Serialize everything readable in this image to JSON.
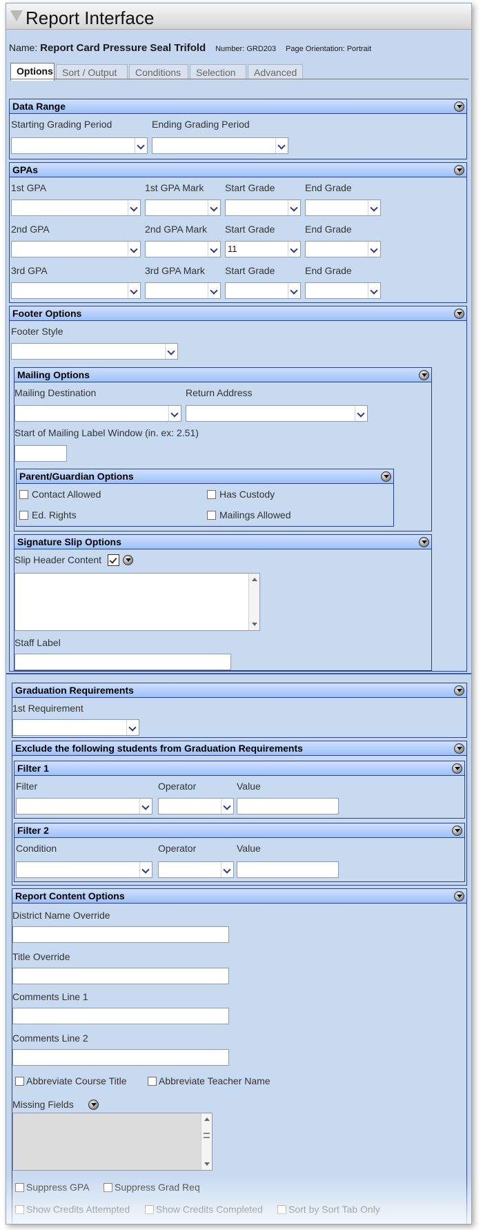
{
  "window": {
    "title": "Report Interface"
  },
  "report": {
    "name_label": "Name:",
    "name": "Report Card Pressure Seal Trifold",
    "number": "Number: GRD203",
    "orientation": "Page Orientation: Portrait"
  },
  "tabs": [
    {
      "label": "Options",
      "active": true
    },
    {
      "label": "Sort / Output"
    },
    {
      "label": "Conditions"
    },
    {
      "label": "Selection"
    },
    {
      "label": "Advanced"
    }
  ],
  "data_range": {
    "title": "Data Range",
    "starting_label": "Starting Grading Period",
    "ending_label": "Ending Grading Period",
    "starting_value": "",
    "ending_value": ""
  },
  "gpas": {
    "title": "GPAs",
    "rows": [
      {
        "gpa_label": "1st GPA",
        "mark_label": "1st GPA Mark",
        "start_label": "Start Grade",
        "end_label": "End Grade",
        "gpa": "",
        "mark": "",
        "start": "",
        "end": ""
      },
      {
        "gpa_label": "2nd GPA",
        "mark_label": "2nd GPA Mark",
        "start_label": "Start Grade",
        "end_label": "End Grade",
        "gpa": "",
        "mark": "",
        "start": "11",
        "end": ""
      },
      {
        "gpa_label": "3rd GPA",
        "mark_label": "3rd GPA Mark",
        "start_label": "Start Grade",
        "end_label": "End Grade",
        "gpa": "",
        "mark": "",
        "start": "",
        "end": ""
      }
    ]
  },
  "footer": {
    "title": "Footer Options",
    "style_label": "Footer Style",
    "style_value": ""
  },
  "mailing": {
    "title": "Mailing Options",
    "destination_label": "Mailing Destination",
    "return_label": "Return Address",
    "window_label": "Start of Mailing Label Window (in. ex: 2.51)",
    "destination_value": "",
    "return_value": "",
    "window_value": ""
  },
  "guardian": {
    "title": "Parent/Guardian Options",
    "contact": "Contact Allowed",
    "custody": "Has Custody",
    "ed_rights": "Ed. Rights",
    "mailings": "Mailings Allowed"
  },
  "signature": {
    "title": "Signature Slip Options",
    "header_label": "Slip Header Content",
    "staff_label": "Staff Label",
    "header_value": "",
    "staff_value": ""
  },
  "grad": {
    "title": "Graduation Requirements",
    "req_label": "1st Requirement",
    "req_value": ""
  },
  "exclude": {
    "title": "Exclude the following students from Graduation Requirements"
  },
  "filter1": {
    "title": "Filter 1",
    "filter_label": "Filter",
    "operator_label": "Operator",
    "value_label": "Value",
    "filter_value": "",
    "operator_value": "",
    "value": ""
  },
  "filter2": {
    "title": "Filter 2",
    "condition_label": "Condition",
    "operator_label": "Operator",
    "value_label": "Value",
    "condition_value": "",
    "operator_value": "",
    "value": ""
  },
  "content": {
    "title": "Report Content Options",
    "district_label": "District Name Override",
    "title_override_label": "Title Override",
    "comments1_label": "Comments Line 1",
    "comments2_label": "Comments Line 2",
    "abbr_course": "Abbreviate Course Title",
    "abbr_teacher": "Abbreviate Teacher Name",
    "missing_label": "Missing Fields",
    "suppress_gpa": "Suppress GPA",
    "suppress_grad": "Suppress Grad Req",
    "show_attempted": "Show Credits Attempted",
    "show_completed": "Show Credits Completed",
    "sort_tab": "Sort by Sort Tab Only"
  },
  "colors": {
    "panel_header": "#9ec1f6",
    "panel_border": "#2b3f8c",
    "background": "#c5d7ee"
  }
}
